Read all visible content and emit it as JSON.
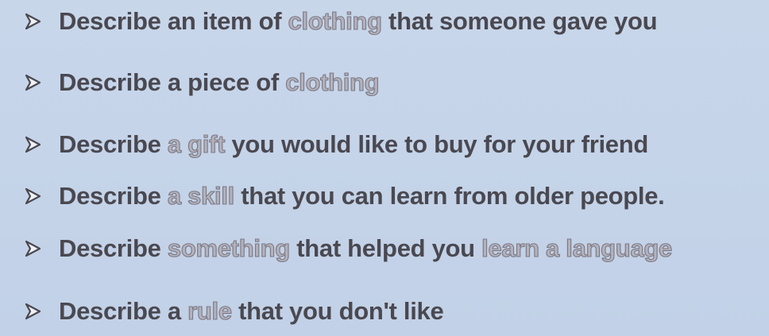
{
  "bullets": [
    {
      "segments": [
        {
          "text": "Describe an item of ",
          "highlight": false
        },
        {
          "text": "clothing",
          "highlight": true
        },
        {
          "text": " that someone gave you",
          "highlight": false
        }
      ]
    },
    {
      "segments": [
        {
          "text": "Describe a piece of ",
          "highlight": false
        },
        {
          "text": "clothing",
          "highlight": true
        }
      ]
    },
    {
      "segments": [
        {
          "text": "Describe ",
          "highlight": false
        },
        {
          "text": "a gift",
          "highlight": true
        },
        {
          "text": " you would like to buy for your friend",
          "highlight": false
        }
      ]
    },
    {
      "segments": [
        {
          "text": "Describe ",
          "highlight": false
        },
        {
          "text": "a skill",
          "highlight": true
        },
        {
          "text": " that you can learn from older people.",
          "highlight": false
        }
      ]
    },
    {
      "segments": [
        {
          "text": "Describe ",
          "highlight": false
        },
        {
          "text": "something",
          "highlight": true
        },
        {
          "text": " that helped you ",
          "highlight": false
        },
        {
          "text": "learn a language",
          "highlight": true
        }
      ]
    },
    {
      "segments": [
        {
          "text": "Describe a ",
          "highlight": false
        },
        {
          "text": "rule",
          "highlight": true
        },
        {
          "text": " that you don't like",
          "highlight": false
        }
      ]
    }
  ],
  "icons": {
    "bullet": "arrow-right-outline-icon"
  },
  "colors": {
    "background": "#c5d4e9",
    "text": "#4a4850",
    "highlight_fill": "#b4b2bc",
    "highlight_outline": "#7a7884"
  }
}
